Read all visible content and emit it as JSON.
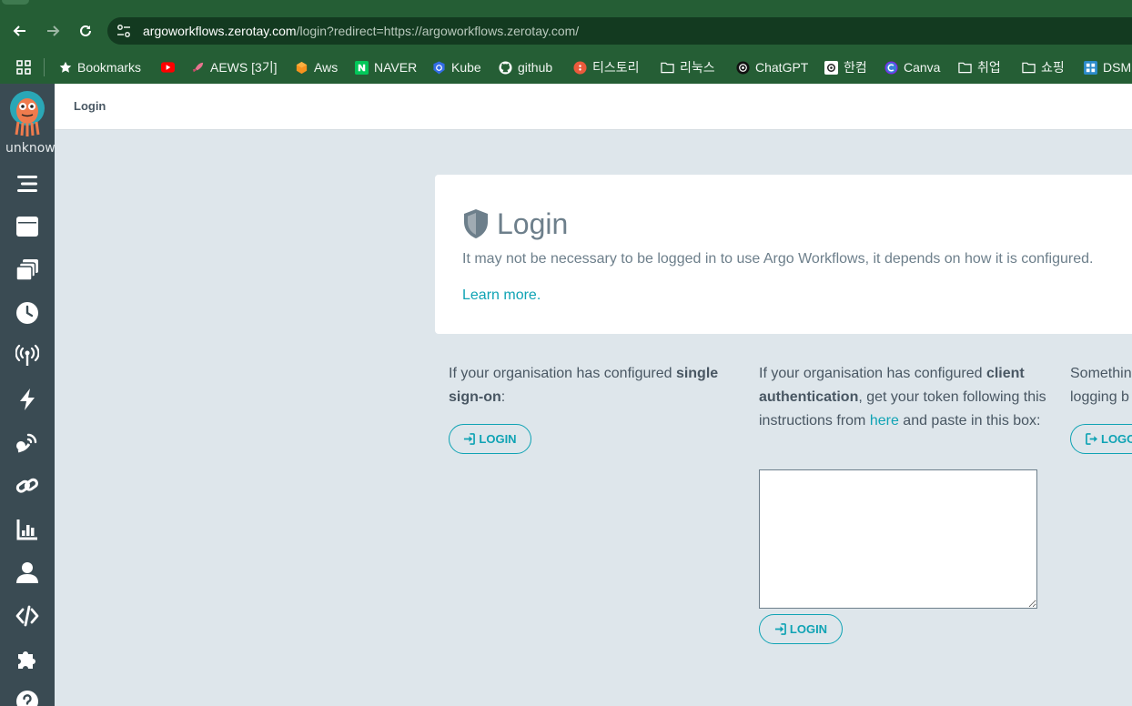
{
  "browser": {
    "url_host": "argoworkflows.zerotay.com",
    "url_path": "/login?redirect=https://argoworkflows.zerotay.com/",
    "bookmarks": [
      {
        "label": "Bookmarks",
        "icon": "star-icon"
      },
      {
        "label": "",
        "icon": "youtube-icon"
      },
      {
        "label": "AEWS [3기]",
        "icon": "rocket-icon"
      },
      {
        "label": "Aws",
        "icon": "aws-icon"
      },
      {
        "label": "NAVER",
        "icon": "naver-icon"
      },
      {
        "label": "Kube",
        "icon": "kubernetes-icon"
      },
      {
        "label": "github",
        "icon": "github-icon"
      },
      {
        "label": "티스토리",
        "icon": "tistory-icon"
      },
      {
        "label": "리눅스",
        "icon": "folder-icon"
      },
      {
        "label": "ChatGPT",
        "icon": "chatgpt-icon"
      },
      {
        "label": "한컴",
        "icon": "hancom-icon"
      },
      {
        "label": "Canva",
        "icon": "canva-icon"
      },
      {
        "label": "취업",
        "icon": "folder-icon"
      },
      {
        "label": "쇼핑",
        "icon": "folder-icon"
      },
      {
        "label": "DSM",
        "icon": "dsm-icon"
      }
    ]
  },
  "sidebar": {
    "user": "unknown",
    "icons": [
      "menu-icon",
      "workflows-icon",
      "workflow-templates-icon",
      "cron-workflows-icon",
      "event-sources-icon",
      "sensors-icon",
      "event-flow-icon",
      "links-icon",
      "reports-icon",
      "user-icon",
      "api-docs-icon",
      "plugins-icon",
      "help-icon"
    ]
  },
  "topbar": {
    "breadcrumb": "Login"
  },
  "login": {
    "title": "Login",
    "description": "It may not be necessary to be logged in to use Argo Workflows, it depends on how it is configured.",
    "learn_more": "Learn more."
  },
  "sso": {
    "text_prefix": "If your organisation has configured ",
    "text_bold": "single sign-on",
    "text_suffix": ":",
    "button": "LOGIN"
  },
  "client_auth": {
    "text_prefix": "If your organisation has configured ",
    "text_bold": "client authentication",
    "text_middle": ", get your token following this instructions from ",
    "link": "here",
    "text_suffix": " and paste in this box:",
    "token_value": "",
    "button": "LOGIN"
  },
  "logout": {
    "line1": "Somethin",
    "line2": "logging b",
    "button": "LOGO"
  },
  "colors": {
    "browser_bar": "#255e35",
    "sidebar": "#3a4b53",
    "accent": "#0fa3b4",
    "page_background": "#dee6eb"
  }
}
